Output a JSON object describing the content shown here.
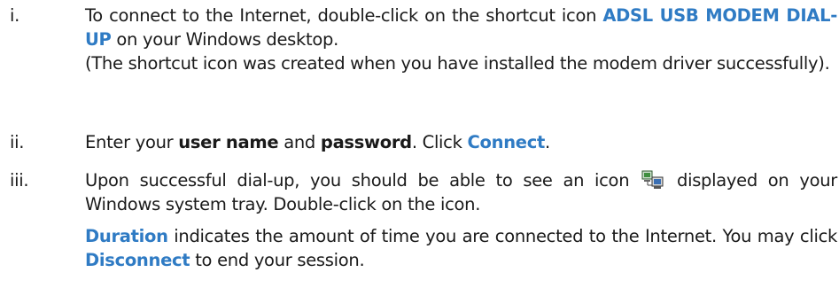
{
  "accent_color": "#2f7bc4",
  "steps": [
    {
      "num": "i.",
      "line1_a": "To connect to the Internet, double-click on the shortcut icon ",
      "line1_kw": "ADSL USB MODEM DIAL-UP",
      "line1_b": " on your Windows desktop.",
      "note": "(The shortcut icon was created when you have installed the modem driver successfully)."
    },
    {
      "num": "ii.",
      "t1": "Enter your ",
      "b1": "user name",
      "t2": " and ",
      "b2": "password",
      "t3": ".  Click ",
      "kw": "Connect",
      "t4": "."
    },
    {
      "num": "iii.",
      "t1": "Upon successful dial-up, you should be able to see an icon",
      "icon": "network-connection-tray-icon",
      "t2": "displayed on your Windows system tray.  Double-click on the icon.",
      "p2_kw1": "Duration",
      "p2_t1": " indicates the amount of time you are connected to the Internet.  You may click ",
      "p2_kw2": "Disconnect",
      "p2_t2": " to end your session."
    }
  ]
}
